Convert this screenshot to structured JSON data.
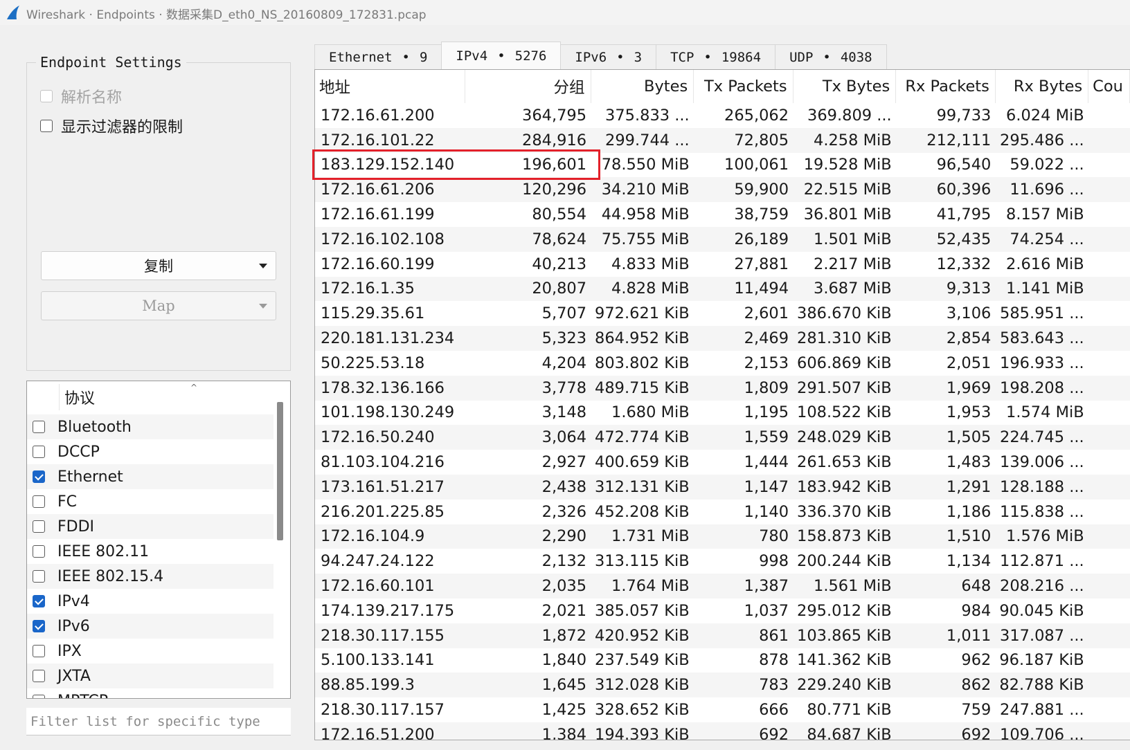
{
  "window": {
    "title": "Wireshark · Endpoints · 数据采集D_eth0_NS_20160809_172831.pcap",
    "logo_icon": "wireshark-fin-icon",
    "logo_color": "#1c6fc4"
  },
  "settings": {
    "legend": "Endpoint Settings",
    "resolve_names": {
      "label": "解析名称",
      "checked": false,
      "enabled": false
    },
    "limit_filter": {
      "label": "显示过滤器的限制",
      "checked": false,
      "enabled": true
    },
    "copy_button": "复制",
    "map_button": "Map"
  },
  "protocols": {
    "header": "协议",
    "items": [
      {
        "label": "Bluetooth",
        "checked": false
      },
      {
        "label": "DCCP",
        "checked": false
      },
      {
        "label": "Ethernet",
        "checked": true
      },
      {
        "label": "FC",
        "checked": false
      },
      {
        "label": "FDDI",
        "checked": false
      },
      {
        "label": "IEEE 802.11",
        "checked": false
      },
      {
        "label": "IEEE 802.15.4",
        "checked": false
      },
      {
        "label": "IPv4",
        "checked": true
      },
      {
        "label": "IPv6",
        "checked": true
      },
      {
        "label": "IPX",
        "checked": false
      },
      {
        "label": "JXTA",
        "checked": false
      },
      {
        "label": "MPTCP",
        "checked": false
      }
    ],
    "filter_placeholder": "Filter list for specific type"
  },
  "tabs": [
    {
      "name": "Ethernet",
      "count": "9",
      "active": false
    },
    {
      "name": "IPv4",
      "count": "5276",
      "active": true
    },
    {
      "name": "IPv6",
      "count": "3",
      "active": false
    },
    {
      "name": "TCP",
      "count": "19864",
      "active": false
    },
    {
      "name": "UDP",
      "count": "4038",
      "active": false
    }
  ],
  "table": {
    "columns": [
      "地址",
      "分组",
      "Bytes",
      "Tx Packets",
      "Tx Bytes",
      "Rx Packets",
      "Rx Bytes",
      "Cou"
    ],
    "highlight_color": "#e3202a",
    "highlighted_row": 2,
    "rows": [
      [
        "172.16.61.200",
        "364,795",
        "375.833 ...",
        "265,062",
        "369.809 ...",
        "99,733",
        "6.024 MiB"
      ],
      [
        "172.16.101.22",
        "284,916",
        "299.744 ...",
        "72,805",
        "4.258 MiB",
        "212,111",
        "295.486 ..."
      ],
      [
        "183.129.152.140",
        "196,601",
        "78.550 MiB",
        "100,061",
        "19.528 MiB",
        "96,540",
        "59.022 ..."
      ],
      [
        "172.16.61.206",
        "120,296",
        "34.210 MiB",
        "59,900",
        "22.515 MiB",
        "60,396",
        "11.696 ..."
      ],
      [
        "172.16.61.199",
        "80,554",
        "44.958 MiB",
        "38,759",
        "36.801 MiB",
        "41,795",
        "8.157 MiB"
      ],
      [
        "172.16.102.108",
        "78,624",
        "75.755 MiB",
        "26,189",
        "1.501 MiB",
        "52,435",
        "74.254 ..."
      ],
      [
        "172.16.60.199",
        "40,213",
        "4.833 MiB",
        "27,881",
        "2.217 MiB",
        "12,332",
        "2.616 MiB"
      ],
      [
        "172.16.1.35",
        "20,807",
        "4.828 MiB",
        "11,494",
        "3.687 MiB",
        "9,313",
        "1.141 MiB"
      ],
      [
        "115.29.35.61",
        "5,707",
        "972.621 KiB",
        "2,601",
        "386.670 KiB",
        "3,106",
        "585.951 ..."
      ],
      [
        "220.181.131.234",
        "5,323",
        "864.952 KiB",
        "2,469",
        "281.310 KiB",
        "2,854",
        "583.643 ..."
      ],
      [
        "50.225.53.18",
        "4,204",
        "803.802 KiB",
        "2,153",
        "606.869 KiB",
        "2,051",
        "196.933 ..."
      ],
      [
        "178.32.136.166",
        "3,778",
        "489.715 KiB",
        "1,809",
        "291.507 KiB",
        "1,969",
        "198.208 ..."
      ],
      [
        "101.198.130.249",
        "3,148",
        "1.680 MiB",
        "1,195",
        "108.522 KiB",
        "1,953",
        "1.574 MiB"
      ],
      [
        "172.16.50.240",
        "3,064",
        "472.774 KiB",
        "1,559",
        "248.029 KiB",
        "1,505",
        "224.745 ..."
      ],
      [
        "81.103.104.216",
        "2,927",
        "400.659 KiB",
        "1,444",
        "261.653 KiB",
        "1,483",
        "139.006 ..."
      ],
      [
        "173.161.51.217",
        "2,438",
        "312.131 KiB",
        "1,147",
        "183.942 KiB",
        "1,291",
        "128.188 ..."
      ],
      [
        "216.201.225.85",
        "2,326",
        "452.208 KiB",
        "1,140",
        "336.370 KiB",
        "1,186",
        "115.838 ..."
      ],
      [
        "172.16.104.9",
        "2,290",
        "1.731 MiB",
        "780",
        "158.873 KiB",
        "1,510",
        "1.576 MiB"
      ],
      [
        "94.247.24.122",
        "2,132",
        "313.115 KiB",
        "998",
        "200.244 KiB",
        "1,134",
        "112.871 ..."
      ],
      [
        "172.16.60.101",
        "2,035",
        "1.764 MiB",
        "1,387",
        "1.561 MiB",
        "648",
        "208.216 ..."
      ],
      [
        "174.139.217.175",
        "2,021",
        "385.057 KiB",
        "1,037",
        "295.012 KiB",
        "984",
        "90.045 KiB"
      ],
      [
        "218.30.117.155",
        "1,872",
        "420.952 KiB",
        "861",
        "103.865 KiB",
        "1,011",
        "317.087 ..."
      ],
      [
        "5.100.133.141",
        "1,840",
        "237.549 KiB",
        "878",
        "141.362 KiB",
        "962",
        "96.187 KiB"
      ],
      [
        "88.85.199.3",
        "1,645",
        "312.028 KiB",
        "783",
        "229.240 KiB",
        "862",
        "82.788 KiB"
      ],
      [
        "218.30.117.157",
        "1,425",
        "328.652 KiB",
        "666",
        "80.771 KiB",
        "759",
        "247.881 ..."
      ],
      [
        "172.16.51.200",
        "1,384",
        "194.393 KiB",
        "692",
        "84.687 KiB",
        "692",
        "109.706 ..."
      ]
    ]
  }
}
